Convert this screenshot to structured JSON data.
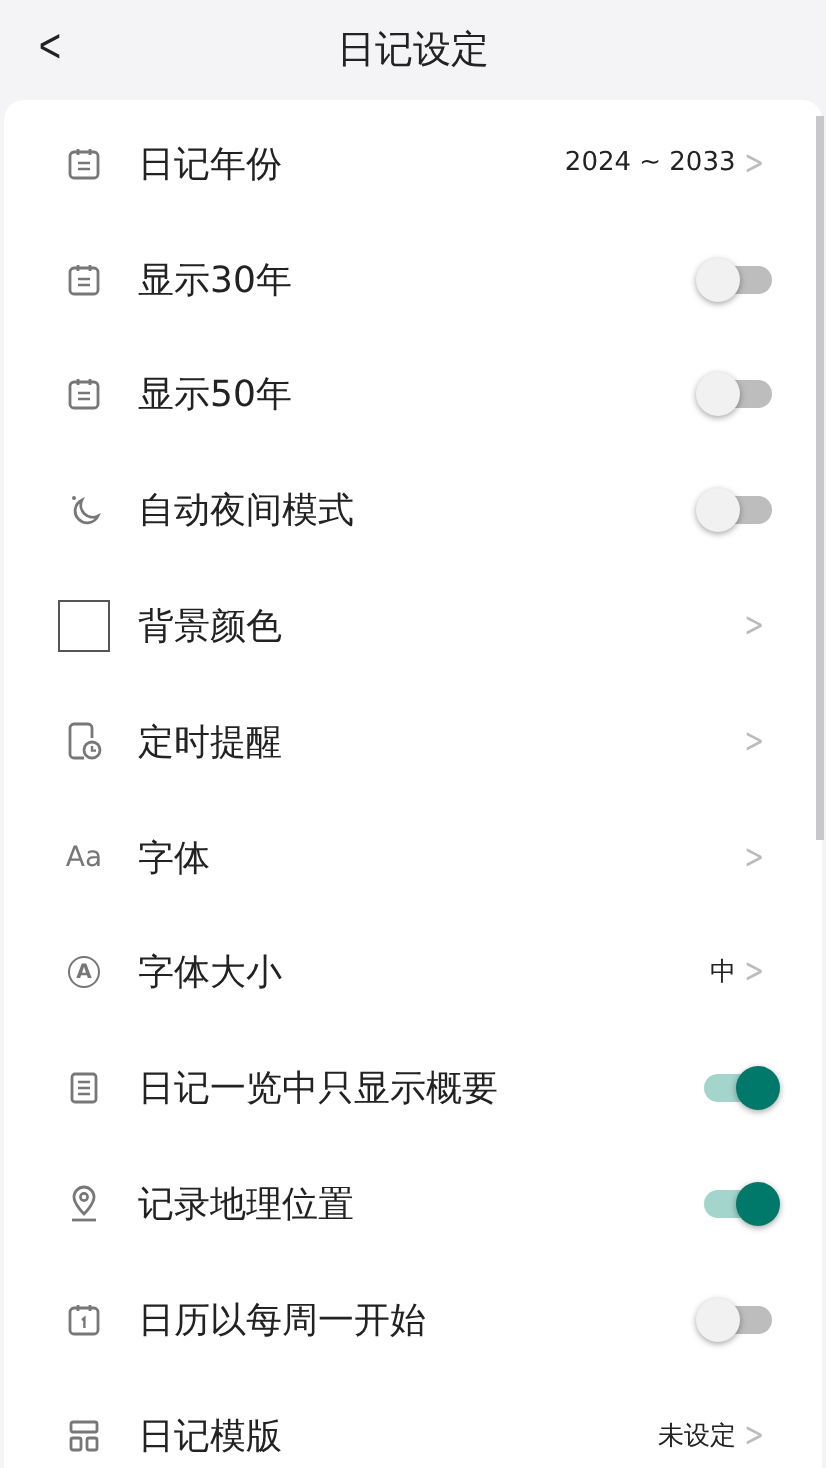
{
  "header": {
    "back": "<",
    "title": "日记设定"
  },
  "rows": [
    {
      "kind": "link",
      "label": "日记年份",
      "value": "2024 ~ 2033",
      "chevron": ">"
    },
    {
      "kind": "toggle",
      "label": "显示30年",
      "on": false
    },
    {
      "kind": "toggle",
      "label": "显示50年",
      "on": false
    },
    {
      "kind": "toggle",
      "label": "自动夜间模式",
      "on": false
    },
    {
      "kind": "link",
      "label": "背景颜色",
      "chevron": ">"
    },
    {
      "kind": "link",
      "label": "定时提醒",
      "chevron": ">"
    },
    {
      "kind": "link",
      "label": "字体",
      "icon_text": "Aa",
      "chevron": ">"
    },
    {
      "kind": "link",
      "label": "字体大小",
      "icon_text": "A",
      "value": "中",
      "chevron": ">"
    },
    {
      "kind": "toggle",
      "label": "日记一览中只显示概要",
      "on": true
    },
    {
      "kind": "toggle",
      "label": "记录地理位置",
      "on": true
    },
    {
      "kind": "toggle",
      "label": "日历以每周一开始",
      "on": false
    },
    {
      "kind": "link",
      "label": "日记模版",
      "value": "未设定",
      "chevron": ">"
    }
  ]
}
